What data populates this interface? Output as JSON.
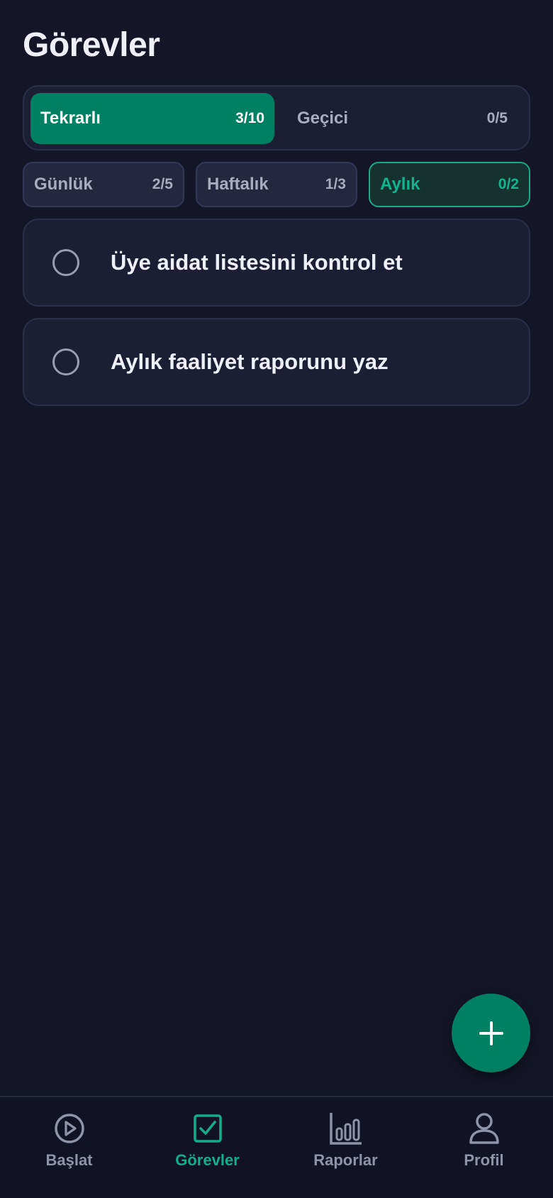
{
  "header": {
    "title": "Görevler"
  },
  "segments": [
    {
      "label": "Tekrarlı",
      "count": "3/10",
      "active": true
    },
    {
      "label": "Geçici",
      "count": "0/5",
      "active": false
    }
  ],
  "filters": [
    {
      "label": "Günlük",
      "count": "2/5",
      "active": false
    },
    {
      "label": "Haftalık",
      "count": "1/3",
      "active": false
    },
    {
      "label": "Aylık",
      "count": "0/2",
      "active": true
    }
  ],
  "tasks": [
    {
      "title": "Üye aidat listesini kontrol et",
      "done": false
    },
    {
      "title": "Aylık faaliyet raporunu yaz",
      "done": false
    }
  ],
  "fab": {
    "icon": "plus-icon"
  },
  "nav": [
    {
      "label": "Başlat",
      "icon": "play-circle-icon",
      "active": false
    },
    {
      "label": "Görevler",
      "icon": "checkbox-icon",
      "active": true
    },
    {
      "label": "Raporlar",
      "icon": "bar-chart-icon",
      "active": false
    },
    {
      "label": "Profil",
      "icon": "user-icon",
      "active": false
    }
  ],
  "colors": {
    "background": "#141628",
    "accent": "#008062",
    "accent_text": "#14b38f",
    "card": "#1c1e33",
    "muted_text": "#a9acbf"
  }
}
